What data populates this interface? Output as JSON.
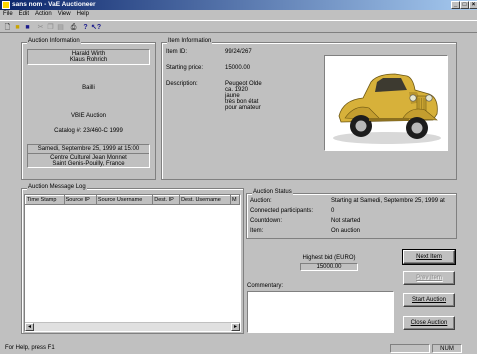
{
  "window": {
    "title": "sans nom - VaE Auctioneer"
  },
  "menu": [
    "File",
    "Edit",
    "Action",
    "View",
    "Help"
  ],
  "toolbar": {
    "icons": [
      "new-document-icon",
      "open-folder-icon",
      "save-icon",
      "cut-icon",
      "copy-icon",
      "paste-icon",
      "print-icon",
      "help-icon",
      "context-help-icon"
    ]
  },
  "auction_info": {
    "label": "Auction Information",
    "auctioneers": [
      "Harald Wirth",
      "Klaus Rohrich"
    ],
    "firm": "Bailli",
    "auction_name": "VBIE Auction",
    "catalog": "Catalog #:  23/460-C 1999",
    "datetime": "Samedi, Septembre 25, 1999 at 15:00",
    "venue": [
      "Centre Culturel Jean Monnet",
      "Saint Genis-Pouilly, France"
    ]
  },
  "item_info": {
    "label": "Item Information",
    "item_id_label": "Item ID:",
    "item_id": "99/24/267",
    "starting_price_label": "Starting price:",
    "starting_price": "15000.00",
    "description_label": "Description:",
    "description_lines": [
      "Peugeot Olde",
      "ca. 1920",
      "jaune",
      "très bon état",
      "pour amateur"
    ]
  },
  "log": {
    "label": "Auction Message Log",
    "columns": [
      "Time Stamp",
      "Source IP",
      "Source Username",
      "Dest. IP",
      "Dest. Username",
      "M"
    ]
  },
  "status": {
    "label": "Auction Status",
    "rows": [
      {
        "key": "Auction:",
        "value": "Starting at Samedi, Septembre 25, 1999 at"
      },
      {
        "key": "Connected participants:",
        "value": "0"
      },
      {
        "key": "Countdown:",
        "value": "Not started"
      },
      {
        "key": "Item:",
        "value": "On auction"
      }
    ]
  },
  "highest_bid": {
    "label": "Highest bid (EURO)",
    "value": "15000.00"
  },
  "commentary": {
    "label": "Commentary:",
    "value": ""
  },
  "buttons": {
    "next_item": "Next Item",
    "prev_item": "Prev Item",
    "start_auction": "Start Auction",
    "close_auction": "Close Auction"
  },
  "statusbar": {
    "help": "For Help, press F1",
    "num": "NUM"
  }
}
